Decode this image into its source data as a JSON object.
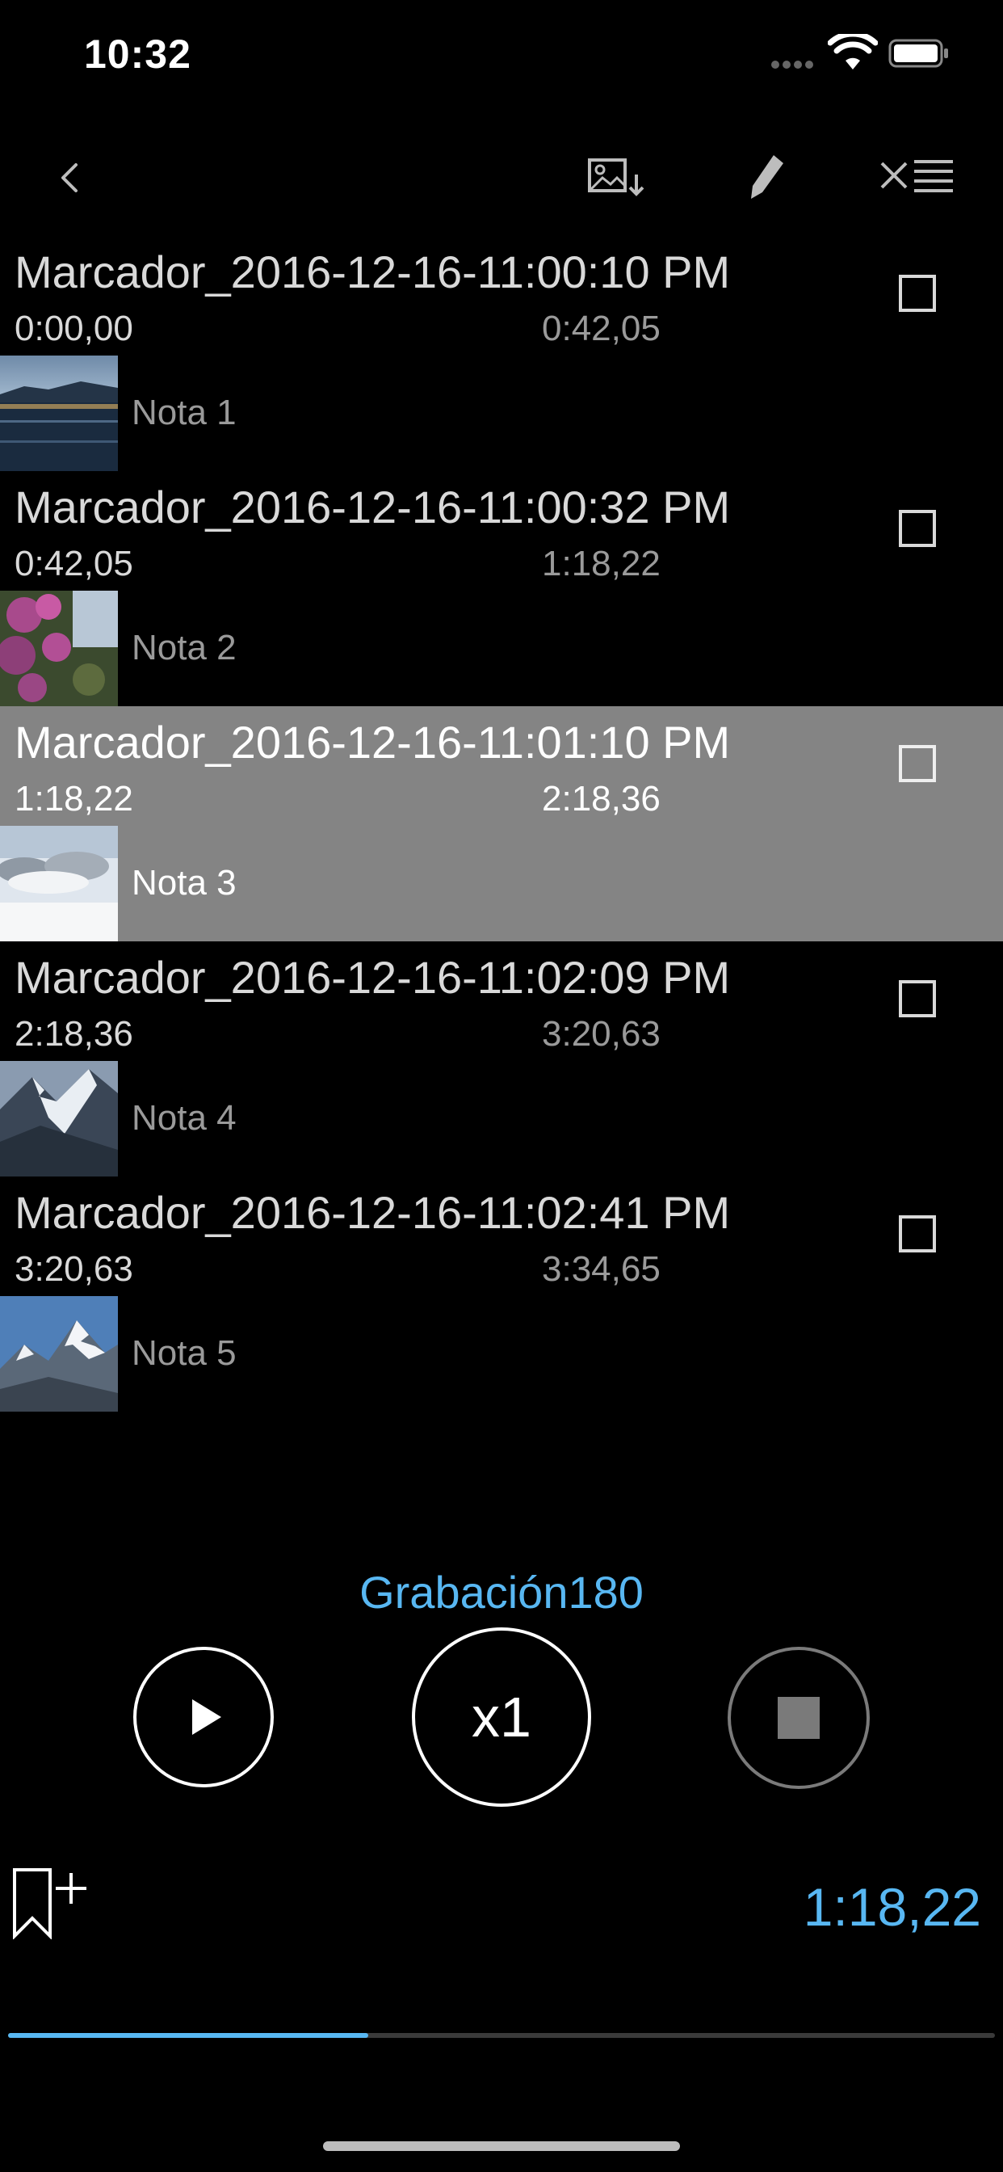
{
  "status": {
    "time": "10:32"
  },
  "colors": {
    "accent": "#58b7f2",
    "selected_row": "#848484",
    "background": "#000000"
  },
  "toolbar": {
    "icons": [
      "back-chevron-icon",
      "image-download-icon",
      "pencil-icon",
      "clear-list-icon"
    ]
  },
  "markers": [
    {
      "title": "Marcador_2016-12-16-11:00:10 PM",
      "start": "0:00,00",
      "end": "0:42,05",
      "note": "Nota 1",
      "selected": false,
      "checked": false
    },
    {
      "title": "Marcador_2016-12-16-11:00:32 PM",
      "start": "0:42,05",
      "end": "1:18,22",
      "note": "Nota 2",
      "selected": false,
      "checked": false
    },
    {
      "title": "Marcador_2016-12-16-11:01:10 PM",
      "start": "1:18,22",
      "end": "2:18,36",
      "note": "Nota 3",
      "selected": true,
      "checked": false
    },
    {
      "title": "Marcador_2016-12-16-11:02:09 PM",
      "start": "2:18,36",
      "end": "3:20,63",
      "note": "Nota 4",
      "selected": false,
      "checked": false
    },
    {
      "title": "Marcador_2016-12-16-11:02:41 PM",
      "start": "3:20,63",
      "end": "3:34,65",
      "note": "Nota 5",
      "selected": false,
      "checked": false
    }
  ],
  "player": {
    "recording_name": "Grabación180",
    "speed_label": "x1",
    "current_time": "1:18,22",
    "progress": 0.365
  }
}
